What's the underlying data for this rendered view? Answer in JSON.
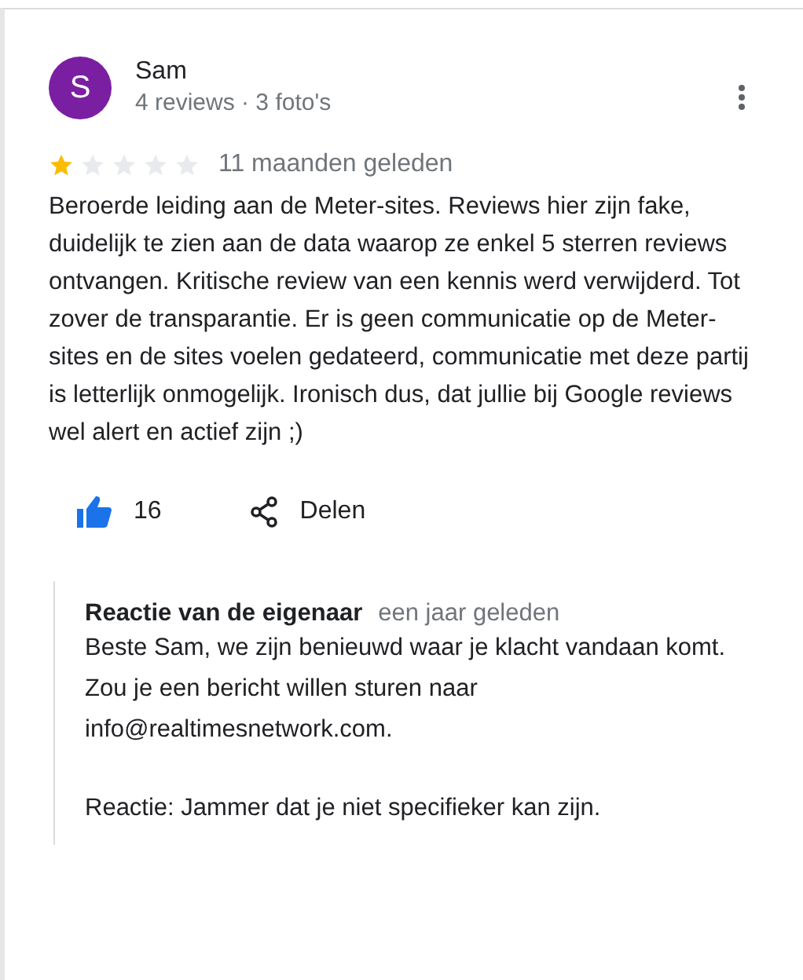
{
  "review": {
    "avatar_letter": "S",
    "author": "Sam",
    "meta": "4 reviews · 3 foto's",
    "stars": 1,
    "time": "11 maanden geleden",
    "text": "Beroerde leiding aan de Meter-sites. Reviews hier zijn fake, duidelijk te zien aan de data waarop ze enkel 5 sterren reviews ontvangen. Kritische review van een kennis werd verwijderd. Tot zover de transparantie. Er is geen communicatie op de Meter-sites en de sites voelen gedateerd, communicatie met deze partij is letterlijk onmogelijk. Ironisch dus, dat jullie bij Google reviews wel alert en actief zijn ;)",
    "likes": {
      "count": "16",
      "liked": true
    },
    "share": "Delen"
  },
  "owner_reply": {
    "title": "Reactie van de eigenaar",
    "time": "een jaar geleden",
    "paragraphs": [
      "Beste Sam, we zijn benieuwd waar je klacht vandaan komt. Zou je een bericht willen sturen naar info@realtimesnetwork.com.",
      "Reactie: Jammer dat je niet specifieker kan zijn."
    ]
  }
}
